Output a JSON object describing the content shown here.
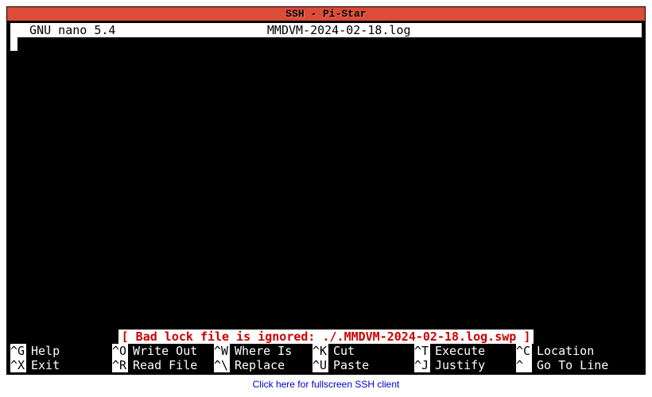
{
  "window": {
    "title": "SSH - Pi-Star"
  },
  "nano": {
    "app_label": "  GNU nano 5.4",
    "filename": "MMDVM-2024-02-18.log",
    "status_message": "[ Bad lock file is ignored: ./.MMDVM-2024-02-18.log.swp ]"
  },
  "shortcuts": {
    "row1": [
      {
        "key": "^G",
        "label": "Help"
      },
      {
        "key": "^O",
        "label": "Write Out"
      },
      {
        "key": "^W",
        "label": "Where Is"
      },
      {
        "key": "^K",
        "label": "Cut"
      },
      {
        "key": "^T",
        "label": "Execute"
      },
      {
        "key": "^C",
        "label": "Location"
      }
    ],
    "row2": [
      {
        "key": "^X",
        "label": "Exit"
      },
      {
        "key": "^R",
        "label": "Read File"
      },
      {
        "key": "^\\",
        "label": "Replace"
      },
      {
        "key": "^U",
        "label": "Paste"
      },
      {
        "key": "^J",
        "label": "Justify"
      },
      {
        "key": "^ ",
        "label": "Go To Line"
      }
    ]
  },
  "footer": {
    "link_text": "Click here for fullscreen SSH client"
  }
}
